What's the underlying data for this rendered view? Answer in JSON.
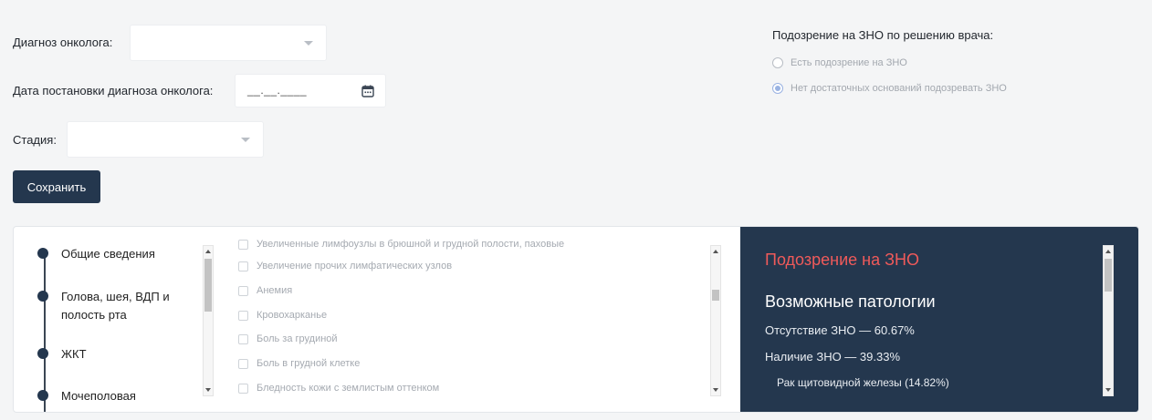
{
  "form": {
    "oncologist_diagnosis_label": "Диагноз онколога:",
    "oncologist_diagnosis_value": "",
    "diagnosis_date_label": "Дата постановки диагноза онколога:",
    "diagnosis_date_value": "__.__.____",
    "stage_label": "Стадия:",
    "stage_value": "",
    "save_label": "Сохранить"
  },
  "suspicion": {
    "title": "Подозрение на ЗНО по решению врача:",
    "options": [
      {
        "label": "Есть подозрение на ЗНО",
        "checked": false
      },
      {
        "label": "Нет достаточных оснований подозревать ЗНО",
        "checked": true
      }
    ]
  },
  "timeline": {
    "items": [
      {
        "label": "Общие сведения"
      },
      {
        "label": "Голова, шея, ВДП и полость рта"
      },
      {
        "label": "ЖКТ"
      },
      {
        "label": "Мочеполовая"
      }
    ]
  },
  "symptoms": {
    "items": [
      {
        "label": "Увеличенные лимфоузлы в брюшной и грудной полости, паховые",
        "checked": false
      },
      {
        "label": "Увеличение прочих лимфатических узлов",
        "checked": false
      },
      {
        "label": "Анемия",
        "checked": false
      },
      {
        "label": "Кровохарканье",
        "checked": false
      },
      {
        "label": "Боль за грудиной",
        "checked": false
      },
      {
        "label": "Боль в грудной клетке",
        "checked": false
      },
      {
        "label": "Бледность кожи с землистым оттенком",
        "checked": false
      }
    ]
  },
  "result": {
    "title": "Подозрение на ЗНО",
    "subtitle": "Возможные патологии",
    "no_zno": "Отсутствие ЗНО — 60.67%",
    "has_zno": "Наличие ЗНО — 39.33%",
    "thyroid": "Рак щитовидной железы (14.82%)"
  },
  "colors": {
    "accent_dark": "#24374e",
    "alert_red": "#f05a5a",
    "radio_selected": "#9ab3e2"
  }
}
